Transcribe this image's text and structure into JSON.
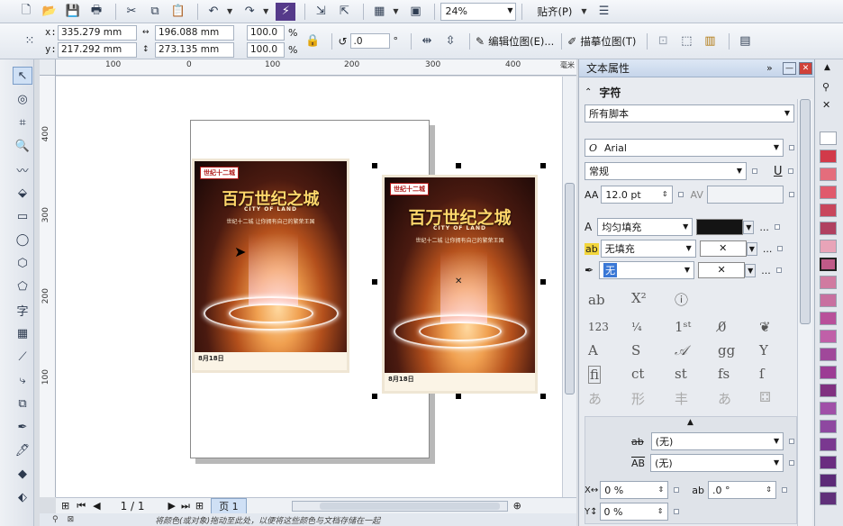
{
  "toolbar": {
    "zoom": "24%",
    "snap_label": "贴齐(P)"
  },
  "property_bar": {
    "x_label": "x:",
    "x_value": "335.279 mm",
    "y_label": "y:",
    "y_value": "217.292 mm",
    "width_value": "196.088 mm",
    "height_value": "273.135 mm",
    "scale_w": "100.0",
    "scale_h": "100.0",
    "percent": "%",
    "rotation": ".0",
    "degree": "°",
    "edit_bitmap": "编辑位图(E)...",
    "trace_bitmap": "描摹位图(T)"
  },
  "ruler": {
    "top_labels": [
      "100",
      "0",
      "100",
      "200",
      "300",
      "400"
    ],
    "left_labels": [
      "400",
      "300",
      "200",
      "100"
    ]
  },
  "poster": {
    "tag": "世纪十二城",
    "title": "百万世纪之城",
    "subtitle": "CITY OF LAND",
    "tagline": "世纪十二城  让你拥有自己的繁荣王国",
    "footer": "8月18日"
  },
  "page_nav": {
    "counter": "1 / 1",
    "page_tab": "页 1"
  },
  "status": {
    "hint": "将颜色(或对象)拖动至此处，以便将这些颜色与文档存储在一起"
  },
  "docker": {
    "title": "文本属性",
    "section": "字符",
    "script": "所有脚本",
    "font": "Arial",
    "style": "常规",
    "size": "12.0 pt",
    "fill_type": "均匀填充",
    "bg_fill": "无填充",
    "outline": "无",
    "strike": "(无)",
    "overline": "(无)",
    "kerning_value": "0 %",
    "y_value": "0 %",
    "angle_value": ".0 °",
    "more": "..."
  },
  "palette": {
    "colors": [
      "#ffffff",
      "#d23a4a",
      "#e46d7c",
      "#e05a6c",
      "#c8465c",
      "#b04060",
      "#e8a4b8",
      "#bf5a88",
      "#d07aa0",
      "#c870a0",
      "#b8509a",
      "#c060a8",
      "#a0489a",
      "#9c3c94",
      "#803080",
      "#a050a8",
      "#8e48a0",
      "#7a3890",
      "#6a2c80",
      "#5c2a78",
      "#60307a"
    ]
  }
}
